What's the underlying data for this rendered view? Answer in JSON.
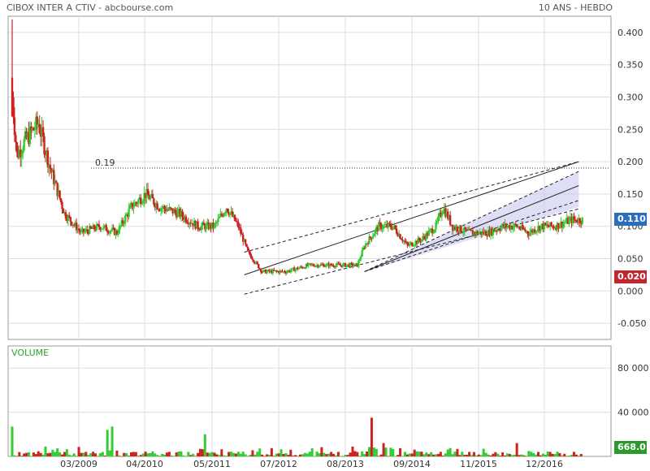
{
  "header": {
    "title": "CIBOX INTER A CTIV - abcbourse.com",
    "period": "10 ANS - HEBDO"
  },
  "badges": {
    "last_price": "0.110",
    "low_price": "0.020",
    "last_volume": "668.0"
  },
  "colors": {
    "up": "#33cc33",
    "down": "#cc2222",
    "channel_fill": "#c8c8f0",
    "grid": "#dddddd",
    "accent_blue": "#2a6fbe"
  },
  "chart_data": [
    {
      "type": "candlestick",
      "title": "CIBOX INTER A CTIV",
      "ylim": [
        -0.075,
        0.425
      ],
      "yticks": [
        "0.400",
        "0.350",
        "0.300",
        "0.250",
        "0.200",
        "0.150",
        "0.100",
        "0.050",
        "0.000",
        "-0.050"
      ],
      "x_tick_labels": [
        "03/2009",
        "04/2010",
        "05/2011",
        "07/2012",
        "08/2013",
        "09/2014",
        "11/2015",
        "12/2016"
      ],
      "grid": true,
      "annotation": {
        "label": "0.19",
        "value": 0.19
      },
      "price_path": [
        {
          "t": 0,
          "close": 0.3
        },
        {
          "t": 4,
          "close": 0.21
        },
        {
          "t": 10,
          "close": 0.23
        },
        {
          "t": 22,
          "close": 0.26
        },
        {
          "t": 32,
          "close": 0.19
        },
        {
          "t": 44,
          "close": 0.12
        },
        {
          "t": 58,
          "close": 0.09
        },
        {
          "t": 74,
          "close": 0.1
        },
        {
          "t": 88,
          "close": 0.09
        },
        {
          "t": 100,
          "close": 0.13
        },
        {
          "t": 112,
          "close": 0.15
        },
        {
          "t": 124,
          "close": 0.13
        },
        {
          "t": 140,
          "close": 0.12
        },
        {
          "t": 156,
          "close": 0.1
        },
        {
          "t": 170,
          "close": 0.1
        },
        {
          "t": 180,
          "close": 0.13
        },
        {
          "t": 190,
          "close": 0.1
        },
        {
          "t": 198,
          "close": 0.06
        },
        {
          "t": 210,
          "close": 0.03
        },
        {
          "t": 230,
          "close": 0.03
        },
        {
          "t": 250,
          "close": 0.04
        },
        {
          "t": 268,
          "close": 0.04
        },
        {
          "t": 290,
          "close": 0.04
        },
        {
          "t": 296,
          "close": 0.07
        },
        {
          "t": 308,
          "close": 0.1
        },
        {
          "t": 320,
          "close": 0.1
        },
        {
          "t": 332,
          "close": 0.07
        },
        {
          "t": 344,
          "close": 0.08
        },
        {
          "t": 356,
          "close": 0.1
        },
        {
          "t": 362,
          "close": 0.13
        },
        {
          "t": 370,
          "close": 0.1
        },
        {
          "t": 384,
          "close": 0.09
        },
        {
          "t": 400,
          "close": 0.09
        },
        {
          "t": 412,
          "close": 0.1
        },
        {
          "t": 424,
          "close": 0.1
        },
        {
          "t": 434,
          "close": 0.09
        },
        {
          "t": 444,
          "close": 0.1
        },
        {
          "t": 456,
          "close": 0.1
        },
        {
          "t": 470,
          "close": 0.11
        }
      ],
      "trend_channel": [
        {
          "t0": 195,
          "v0": 0.025,
          "t1": 476,
          "v1": 0.2,
          "dashed": false
        },
        {
          "t0": 195,
          "v0": -0.005,
          "t1": 476,
          "v1": 0.127,
          "dashed": true
        },
        {
          "t0": 195,
          "v0": 0.06,
          "t1": 476,
          "v1": 0.2,
          "dashed": true
        },
        {
          "t0": 296,
          "v0": 0.03,
          "t1": 476,
          "v1": 0.163,
          "dashed": false
        },
        {
          "t0": 296,
          "v0": 0.03,
          "t1": 476,
          "v1": 0.14,
          "dashed": true
        },
        {
          "t0": 296,
          "v0": 0.03,
          "t1": 476,
          "v1": 0.185,
          "dashed": true
        }
      ]
    },
    {
      "type": "bar",
      "title": "VOLUME",
      "ylim": [
        0,
        100000
      ],
      "yticks": [
        "80 000",
        "40 000"
      ],
      "volume_spikes": [
        {
          "t": 0,
          "value": 27000
        },
        {
          "t": 80,
          "value": 24000
        },
        {
          "t": 84,
          "value": 27000
        },
        {
          "t": 162,
          "value": 20000
        },
        {
          "t": 302,
          "value": 35000
        },
        {
          "t": 312,
          "value": 12000
        },
        {
          "t": 424,
          "value": 12000
        }
      ]
    }
  ]
}
